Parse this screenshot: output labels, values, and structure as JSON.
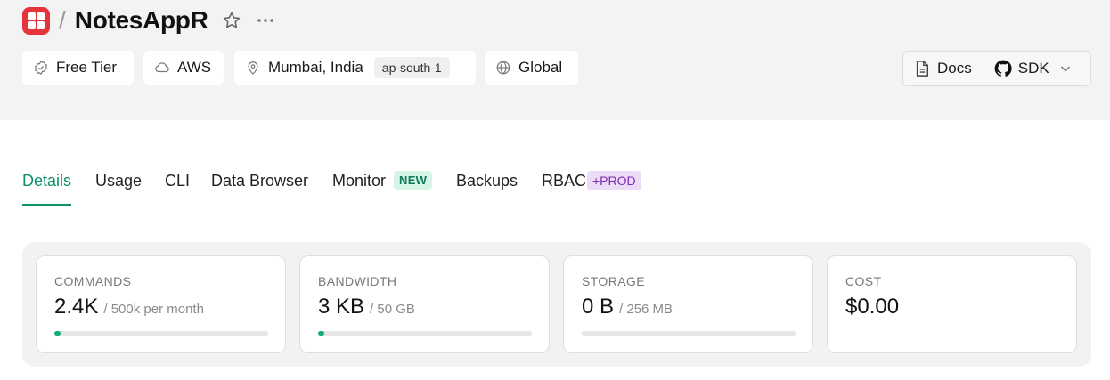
{
  "header": {
    "app_name": "NotesAppR",
    "separator": "/",
    "tags": [
      {
        "label": "Free Tier",
        "icon": "badge-check-icon"
      },
      {
        "label": "AWS",
        "icon": "cloud-icon"
      },
      {
        "label": "Mumbai, India",
        "region_code": "ap-south-1",
        "icon": "map-pin-icon"
      },
      {
        "label": "Global",
        "icon": "globe-icon"
      }
    ],
    "docs_label": "Docs",
    "sdk_label": "SDK"
  },
  "tabs": [
    {
      "label": "Details",
      "active": true
    },
    {
      "label": "Usage"
    },
    {
      "label": "CLI"
    },
    {
      "label": "Data Browser"
    },
    {
      "label": "Monitor",
      "badge": "NEW"
    },
    {
      "label": "Backups"
    },
    {
      "label": "RBAC",
      "badge": "+PROD"
    }
  ],
  "stats": [
    {
      "label": "COMMANDS",
      "value": "2.4K",
      "limit": "/ 500k per month",
      "progress": 0.005
    },
    {
      "label": "BANDWIDTH",
      "value": "3 KB",
      "limit": "/ 50 GB",
      "progress": 0.005
    },
    {
      "label": "STORAGE",
      "value": "0 B",
      "limit": "/ 256 MB",
      "progress": 0.0
    },
    {
      "label": "COST",
      "value": "$0.00"
    }
  ],
  "colors": {
    "brand": "#e5343c",
    "accent": "#0d8f6b",
    "progress": "#10b07f",
    "new_badge_bg": "#d7f5e6",
    "prod_badge_bg": "#ecdcf7"
  }
}
